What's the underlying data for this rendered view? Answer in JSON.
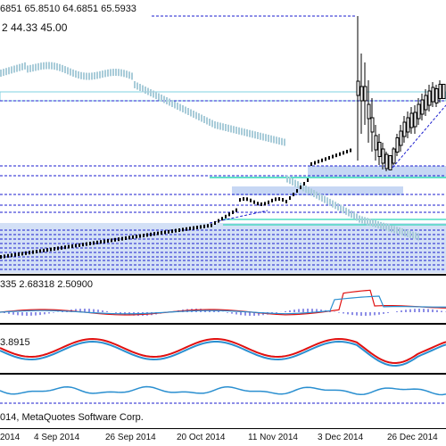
{
  "main_ohlc_text": "6851 65.8510 64.6851 65.5933",
  "main_ma_text": "2 44.33 45.00",
  "macd_text": "335 2.68318 2.50900",
  "stoch_text": "3.8915",
  "copyright_text": "014, MetaQuotes Software Corp.",
  "x_dates": [
    "2014",
    "4 Sep 2014",
    "26 Sep 2014",
    "20 Oct 2014",
    "11 Nov 2014",
    "3 Dec 2014",
    "26 Dec 2014"
  ],
  "colors": {
    "bull_candle": "#000000",
    "faded_candle": "#a9ccd9",
    "dashed_blue": "#1b1ecf",
    "zone_fill": "#c7d7f4",
    "teal_line": "#2fd6b6",
    "macd_red": "#e01010",
    "macd_blue": "#2a8fd0",
    "stoch_red": "#e01010",
    "stoch_blue": "#2a8fd0",
    "lower_line": "#2a8fd0"
  }
}
